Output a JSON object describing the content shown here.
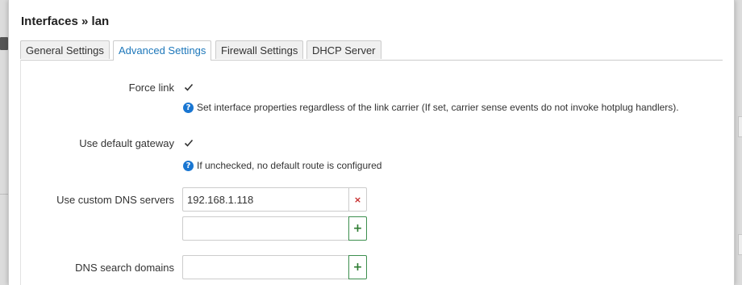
{
  "dialog": {
    "title": "Interfaces » lan"
  },
  "tabs": [
    {
      "label": "General Settings",
      "active": false
    },
    {
      "label": "Advanced Settings",
      "active": true
    },
    {
      "label": "Firewall Settings",
      "active": false
    },
    {
      "label": "DHCP Server",
      "active": false
    }
  ],
  "fields": {
    "force_link": {
      "label": "Force link",
      "checked": true,
      "help": "Set interface properties regardless of the link carrier (If set, carrier sense events do not invoke hotplug handlers)."
    },
    "default_gateway": {
      "label": "Use default gateway",
      "checked": true,
      "help": "If unchecked, no default route is configured"
    },
    "custom_dns": {
      "label": "Use custom DNS servers",
      "entries": [
        "192.168.1.118"
      ],
      "new_entry_value": "",
      "remove_symbol": "×",
      "add_symbol": "+"
    },
    "dns_search": {
      "label": "DNS search domains",
      "new_entry_value": "",
      "add_symbol": "+"
    }
  },
  "help_symbol": "?",
  "colors": {
    "accent": "#1d77ba",
    "help_icon": "#1976d2",
    "add_button": "#2e7d32",
    "remove_button": "#c62828"
  }
}
